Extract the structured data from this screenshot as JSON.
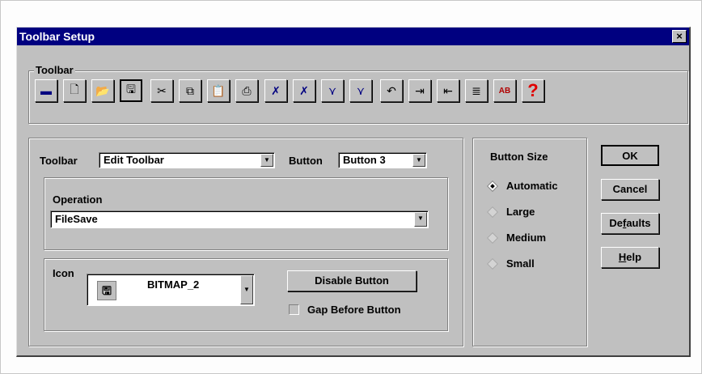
{
  "window": {
    "title": "Toolbar Setup",
    "close_glyph": "×"
  },
  "toolbar_group": {
    "label": "Toolbar",
    "buttons": [
      {
        "name": "tape-icon",
        "glyph": "▬"
      },
      {
        "name": "new-file-icon",
        "glyph": "🗋"
      },
      {
        "name": "open-folder-icon",
        "glyph": "📂"
      },
      {
        "name": "floppy-save-icon",
        "glyph": "🖫"
      },
      {
        "name": "scissors-icon",
        "glyph": "✂"
      },
      {
        "name": "copy-icon",
        "glyph": "⧉"
      },
      {
        "name": "paste-icon",
        "glyph": "📋"
      },
      {
        "name": "printer-icon",
        "glyph": "⎙"
      },
      {
        "name": "curve-edit-icon",
        "glyph": "✗"
      },
      {
        "name": "curve-edit-2-icon",
        "glyph": "✗"
      },
      {
        "name": "line-fit-icon",
        "glyph": "⋎"
      },
      {
        "name": "line-fit-2-icon",
        "glyph": "⋎"
      },
      {
        "name": "undo-icon",
        "glyph": "↶"
      },
      {
        "name": "indent-icon",
        "glyph": "⇥"
      },
      {
        "name": "outdent-icon",
        "glyph": "⇤"
      },
      {
        "name": "list-icon",
        "glyph": "≣"
      },
      {
        "name": "binary-ab-icon",
        "glyph": "AB"
      },
      {
        "name": "help-question-icon",
        "glyph": "?"
      }
    ]
  },
  "settings": {
    "toolbar_label": "Toolbar",
    "toolbar_value": "Edit Toolbar",
    "button_label": "Button",
    "button_value": "Button 3",
    "operation_label": "Operation",
    "operation_value": "FileSave",
    "icon_label": "Icon",
    "icon_value": "BITMAP_2",
    "disable_button_label": "Disable Button",
    "gap_before_label": "Gap Before Button"
  },
  "button_size": {
    "label": "Button Size",
    "options": [
      "Automatic",
      "Large",
      "Medium",
      "Small"
    ],
    "selected": "Automatic"
  },
  "actions": {
    "ok": "OK",
    "cancel": "Cancel",
    "defaults_pre": "De",
    "defaults_u": "f",
    "defaults_post": "aults",
    "help_u": "H",
    "help_post": "elp"
  }
}
